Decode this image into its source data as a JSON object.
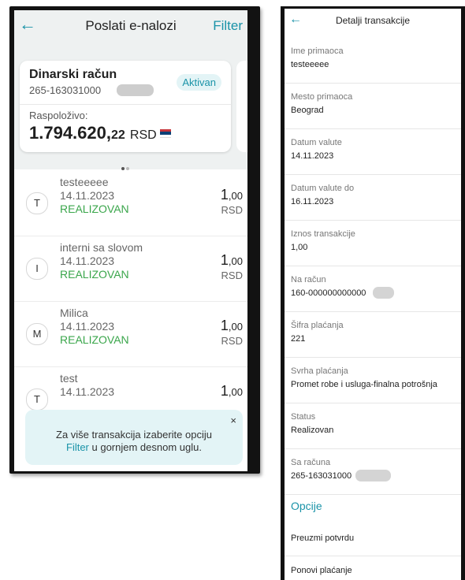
{
  "left": {
    "header": {
      "title": "Poslati e-nalozi",
      "filter_label": "Filter",
      "back_icon": "arrow-left-icon"
    },
    "account": {
      "name": "Dinarski račun",
      "number": "265-163031000",
      "badge": "Aktivan",
      "available_label": "Raspoloživo:",
      "amount_int": "1.794.620,",
      "amount_dec": "22",
      "currency": "RSD"
    },
    "transactions": [
      {
        "initial": "T",
        "name": "testeeeee",
        "date": "14.11.2023",
        "status": "REALIZOVAN",
        "amount_int": "1",
        "amount_dec": ",00",
        "currency": "RSD"
      },
      {
        "initial": "I",
        "name": "interni sa slovom",
        "date": "14.11.2023",
        "status": "REALIZOVAN",
        "amount_int": "1",
        "amount_dec": ",00",
        "currency": "RSD"
      },
      {
        "initial": "M",
        "name": "Milica",
        "date": "14.11.2023",
        "status": "REALIZOVAN",
        "amount_int": "1",
        "amount_dec": ",00",
        "currency": "RSD"
      },
      {
        "initial": "T",
        "name": "test",
        "date": "14.11.2023",
        "status": "",
        "amount_int": "1",
        "amount_dec": ",00",
        "currency": ""
      }
    ],
    "tip": {
      "line1": "Za više transakcija izaberite opciju",
      "line2_link": "Filter",
      "line2_rest": " u gornjem desnom uglu.",
      "close": "×"
    }
  },
  "right": {
    "header": {
      "title": "Detalji transakcije",
      "back_icon": "arrow-left-icon"
    },
    "details": [
      {
        "label": "Ime primaoca",
        "value": "testeeeee"
      },
      {
        "label": "Mesto primaoca",
        "value": "Beograd"
      },
      {
        "label": "Datum valute",
        "value": "14.11.2023"
      },
      {
        "label": "Datum valute do",
        "value": "16.11.2023"
      },
      {
        "label": "Iznos transakcije",
        "value": "1,00"
      },
      {
        "label": "Na račun",
        "value": "160-000000000000"
      },
      {
        "label": "Šifra plaćanja",
        "value": "221"
      },
      {
        "label": "Svrha plaćanja",
        "value": "Promet robe i usluga-finalna potrošnja"
      },
      {
        "label": "Status",
        "value": "Realizovan"
      },
      {
        "label": "Sa računa",
        "value": "265-163031000"
      }
    ],
    "options_title": "Opcije",
    "options": [
      "Preuzmi potvrdu",
      "Ponovi plaćanje"
    ]
  },
  "colors": {
    "accent": "#1a93a8",
    "success": "#3aa64b",
    "badge_bg": "#e3f4f6"
  }
}
